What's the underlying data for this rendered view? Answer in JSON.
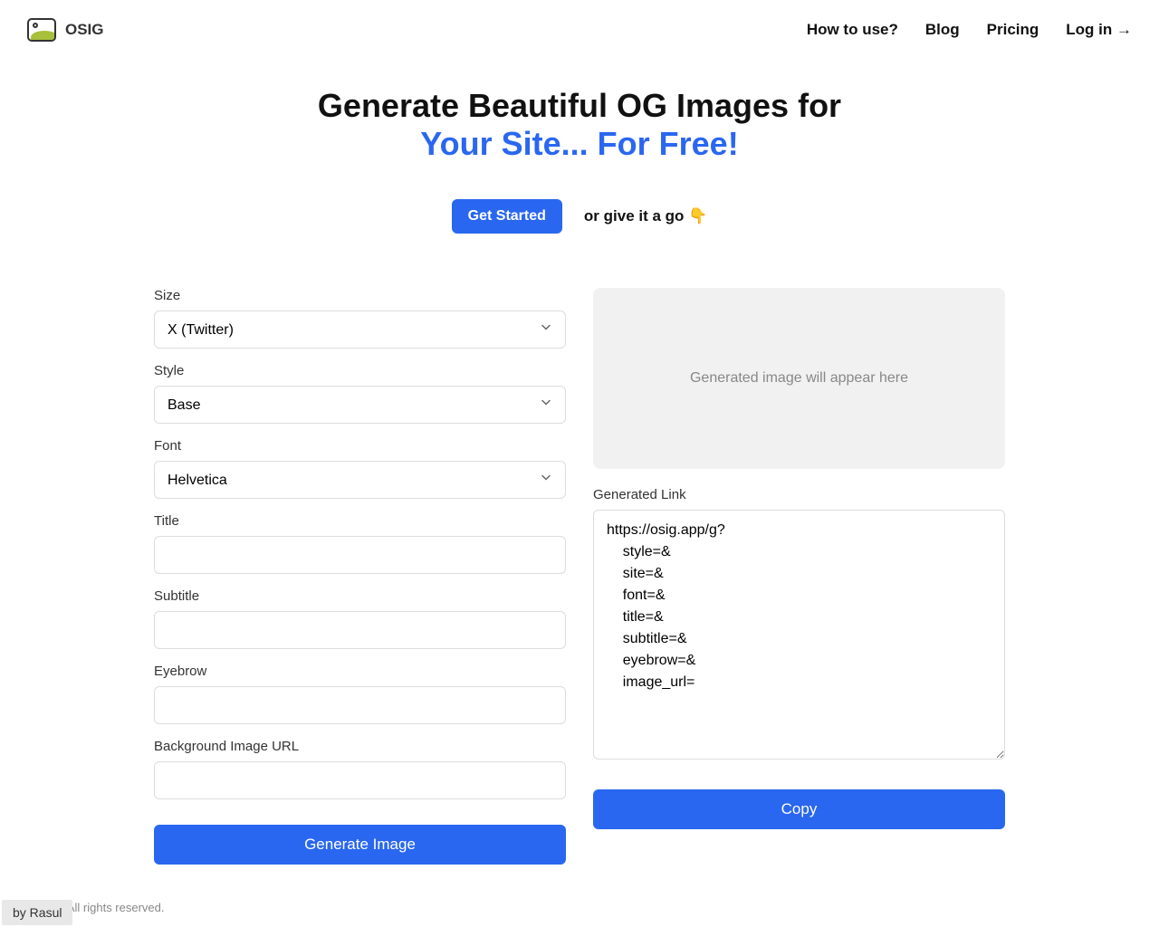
{
  "brand": "OSIG",
  "nav": {
    "howto": "How to use?",
    "blog": "Blog",
    "pricing": "Pricing",
    "login": "Log in →"
  },
  "hero": {
    "line1": "Generate Beautiful OG Images for",
    "line2": "Your Site... For Free!",
    "get_started": "Get Started",
    "or_text": "or give it a go 👇"
  },
  "form": {
    "size_label": "Size",
    "size_value": "X (Twitter)",
    "style_label": "Style",
    "style_value": "Base",
    "font_label": "Font",
    "font_value": "Helvetica",
    "title_label": "Title",
    "title_value": "",
    "subtitle_label": "Subtitle",
    "subtitle_value": "",
    "eyebrow_label": "Eyebrow",
    "eyebrow_value": "",
    "bgurl_label": "Background Image URL",
    "bgurl_value": "",
    "generate_btn": "Generate Image"
  },
  "preview": {
    "placeholder": "Generated image will appear here",
    "link_label": "Generated Link",
    "link_value": "https://osig.app/g?\n    style=&\n    site=&\n    font=&\n    title=&\n    subtitle=&\n    eyebrow=&\n    image_url=",
    "copy_btn": "Copy"
  },
  "footer": {
    "by": "by Rasul",
    "copyright": "LVTD, LLC. All rights reserved."
  }
}
